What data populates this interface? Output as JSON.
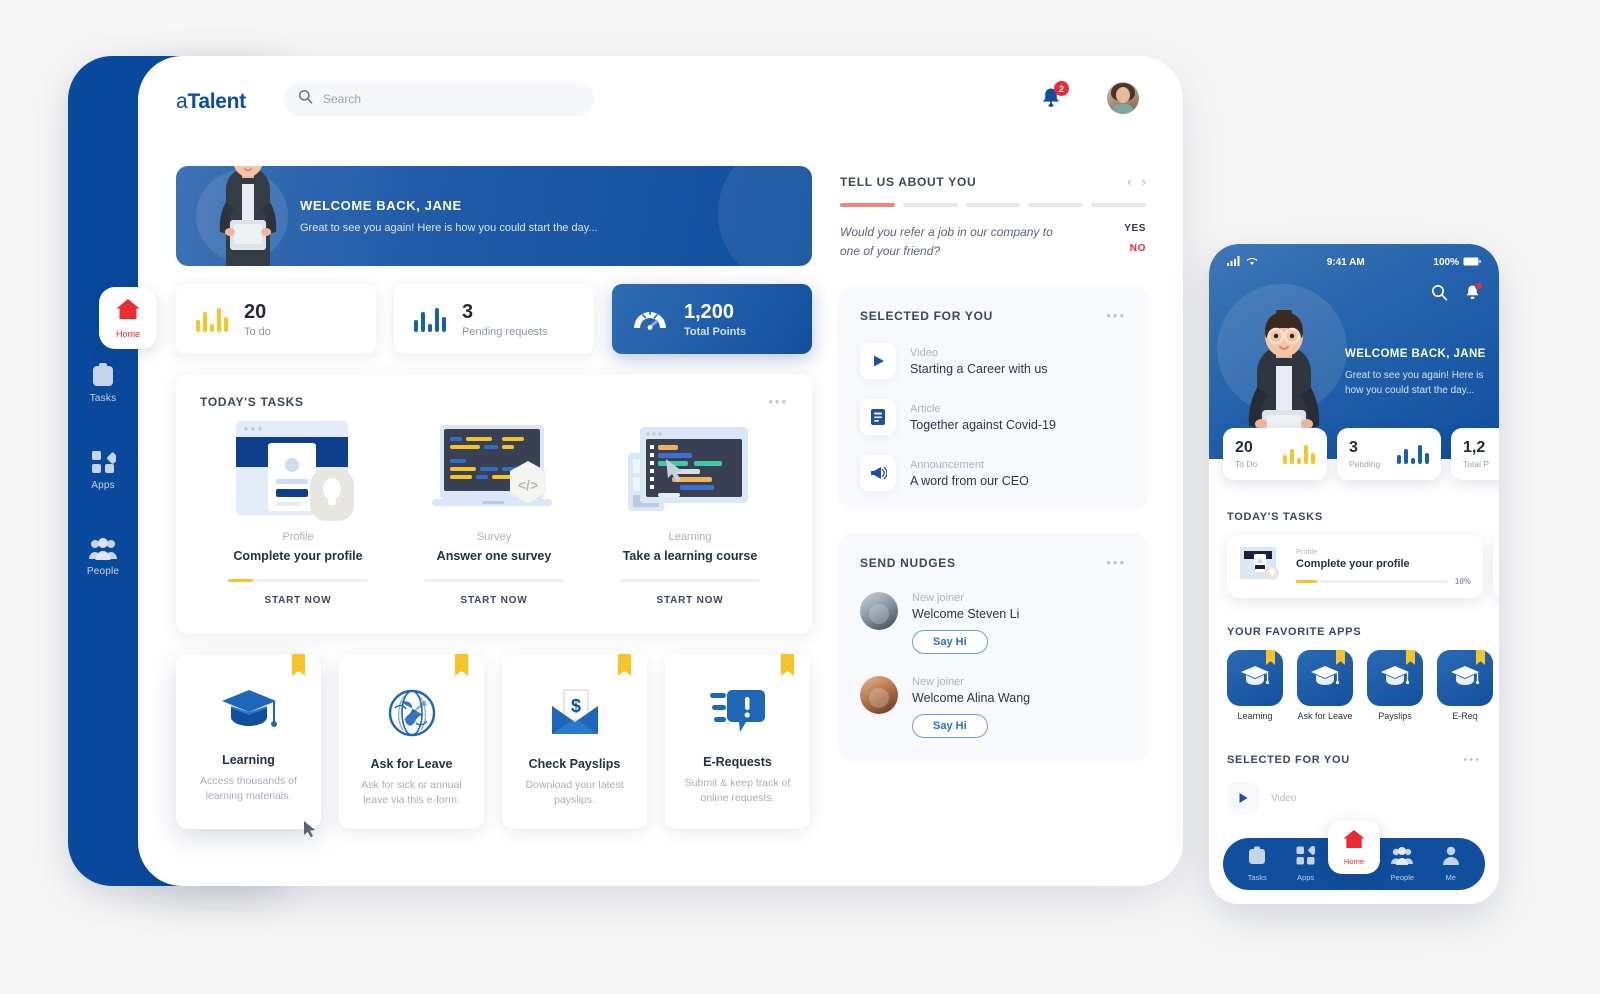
{
  "brand": {
    "name_prefix": "a",
    "name_bold": "Talent",
    "primary": "#0f4f9e",
    "accent_red": "#ea2a35",
    "accent_yellow": "#f7c427"
  },
  "topbar": {
    "search_placeholder": "Search",
    "search_value": "",
    "search_icon": "search-icon",
    "notification_count": "2",
    "bell_icon": "bell-icon",
    "avatar_alt": "Jane"
  },
  "sidebar": {
    "items": [
      {
        "label": "Home",
        "icon": "home-icon",
        "active": true
      },
      {
        "label": "Tasks",
        "icon": "clipboard-icon",
        "active": false
      },
      {
        "label": "Apps",
        "icon": "grid-icon",
        "active": false
      },
      {
        "label": "People",
        "icon": "people-icon",
        "active": false
      }
    ]
  },
  "welcome": {
    "title": "WELCOME BACK, JANE",
    "subtitle": "Great to see you again! Here is how you could start the day..."
  },
  "stats": [
    {
      "value": "20",
      "label": "To do",
      "icon": "bar-chart-icon",
      "color": "#f7c427",
      "accent": false
    },
    {
      "value": "3",
      "label": "Pending requests",
      "icon": "bar-chart-icon",
      "color": "#1a5fae",
      "accent": false
    },
    {
      "value": "1,200",
      "label": "Total Points",
      "icon": "gauge-icon",
      "color": "#ffffff",
      "accent": true
    }
  ],
  "todays_tasks": {
    "title": "TODAY'S TASKS",
    "menu_icon": "more-dots-icon",
    "items": [
      {
        "category": "Profile",
        "name": "Complete your profile",
        "cta": "START NOW",
        "progress": 10,
        "art": "profile-card-art"
      },
      {
        "category": "Survey",
        "name": "Answer one survey",
        "cta": "START NOW",
        "progress": 0,
        "art": "laptop-code-art"
      },
      {
        "category": "Learning",
        "name": "Take a learning course",
        "cta": "START NOW",
        "progress": 0,
        "art": "learning-screen-art"
      }
    ]
  },
  "apps": [
    {
      "name": "Learning",
      "desc": "Access thousands of learning materials.",
      "icon": "graduation-cap-icon",
      "bookmarked": true
    },
    {
      "name": "Ask for Leave",
      "desc": "Ask for sick or annual leave via this e-form.",
      "icon": "globe-icon",
      "bookmarked": true
    },
    {
      "name": "Check Payslips",
      "desc": "Download your latest payslips.",
      "icon": "envelope-dollar-icon",
      "bookmarked": true
    },
    {
      "name": "E-Requests",
      "desc": "Submit & keep track of online requests.",
      "icon": "chat-exclamation-icon",
      "bookmarked": true
    }
  ],
  "tell_us": {
    "title": "TELL US ABOUT YOU",
    "prev_icon": "chevron-left-icon",
    "next_icon": "chevron-right-icon",
    "steps_total": 5,
    "steps_done": 1,
    "question": "Would you refer a job in our company to one of your friend?",
    "yes_label": "YES",
    "no_label": "NO"
  },
  "selected_for_you": {
    "title": "SELECTED FOR YOU",
    "menu_icon": "more-dots-icon",
    "items": [
      {
        "category": "Video",
        "title": "Starting a Career with us",
        "icon": "play-icon"
      },
      {
        "category": "Article",
        "title": "Together against Covid-19",
        "icon": "document-icon"
      },
      {
        "category": "Announcement",
        "title": "A word from our CEO",
        "icon": "megaphone-icon"
      }
    ]
  },
  "send_nudges": {
    "title": "SEND NUDGES",
    "menu_icon": "more-dots-icon",
    "items": [
      {
        "category": "New joiner",
        "title": "Welcome Steven Li",
        "button": "Say Hi"
      },
      {
        "category": "New joiner",
        "title": "Welcome Alina Wang",
        "button": "Say Hi"
      }
    ]
  },
  "mobile": {
    "status": {
      "time": "9:41 AM",
      "battery": "100%",
      "signal_icon": "signal-icon",
      "wifi_icon": "wifi-icon"
    },
    "search_icon": "search-icon",
    "bell_icon": "bell-icon",
    "welcome": {
      "title": "WELCOME BACK, JANE",
      "subtitle": "Great to see you again! Here is how you could start the day..."
    },
    "stats": [
      {
        "value": "20",
        "label": "To Do",
        "color": "#f7c427"
      },
      {
        "value": "3",
        "label": "Pending",
        "color": "#1a5fae"
      },
      {
        "value": "1,2",
        "label": "Total P",
        "color": "#1a5fae"
      }
    ],
    "tasks_title": "TODAY'S TASKS",
    "task": {
      "category": "Profile",
      "name": "Complete your profile",
      "progress_label": "10%",
      "progress": 10
    },
    "apps_title": "YOUR FAVORITE APPS",
    "apps": [
      {
        "name": "Learning",
        "icon": "graduation-cap-icon"
      },
      {
        "name": "Ask for Leave",
        "icon": "graduation-cap-icon"
      },
      {
        "name": "Payslips",
        "icon": "graduation-cap-icon"
      },
      {
        "name": "E-Req",
        "icon": "graduation-cap-icon"
      }
    ],
    "selected_title": "SELECTED FOR YOU",
    "selected_menu_icon": "more-dots-icon",
    "selected_item": {
      "category": "Video",
      "icon": "play-icon"
    },
    "tabs": [
      {
        "label": "Tasks",
        "icon": "clipboard-icon"
      },
      {
        "label": "Apps",
        "icon": "grid-icon"
      },
      {
        "label": "Home",
        "icon": "home-icon"
      },
      {
        "label": "People",
        "icon": "people-icon"
      },
      {
        "label": "Me",
        "icon": "person-icon"
      }
    ]
  }
}
